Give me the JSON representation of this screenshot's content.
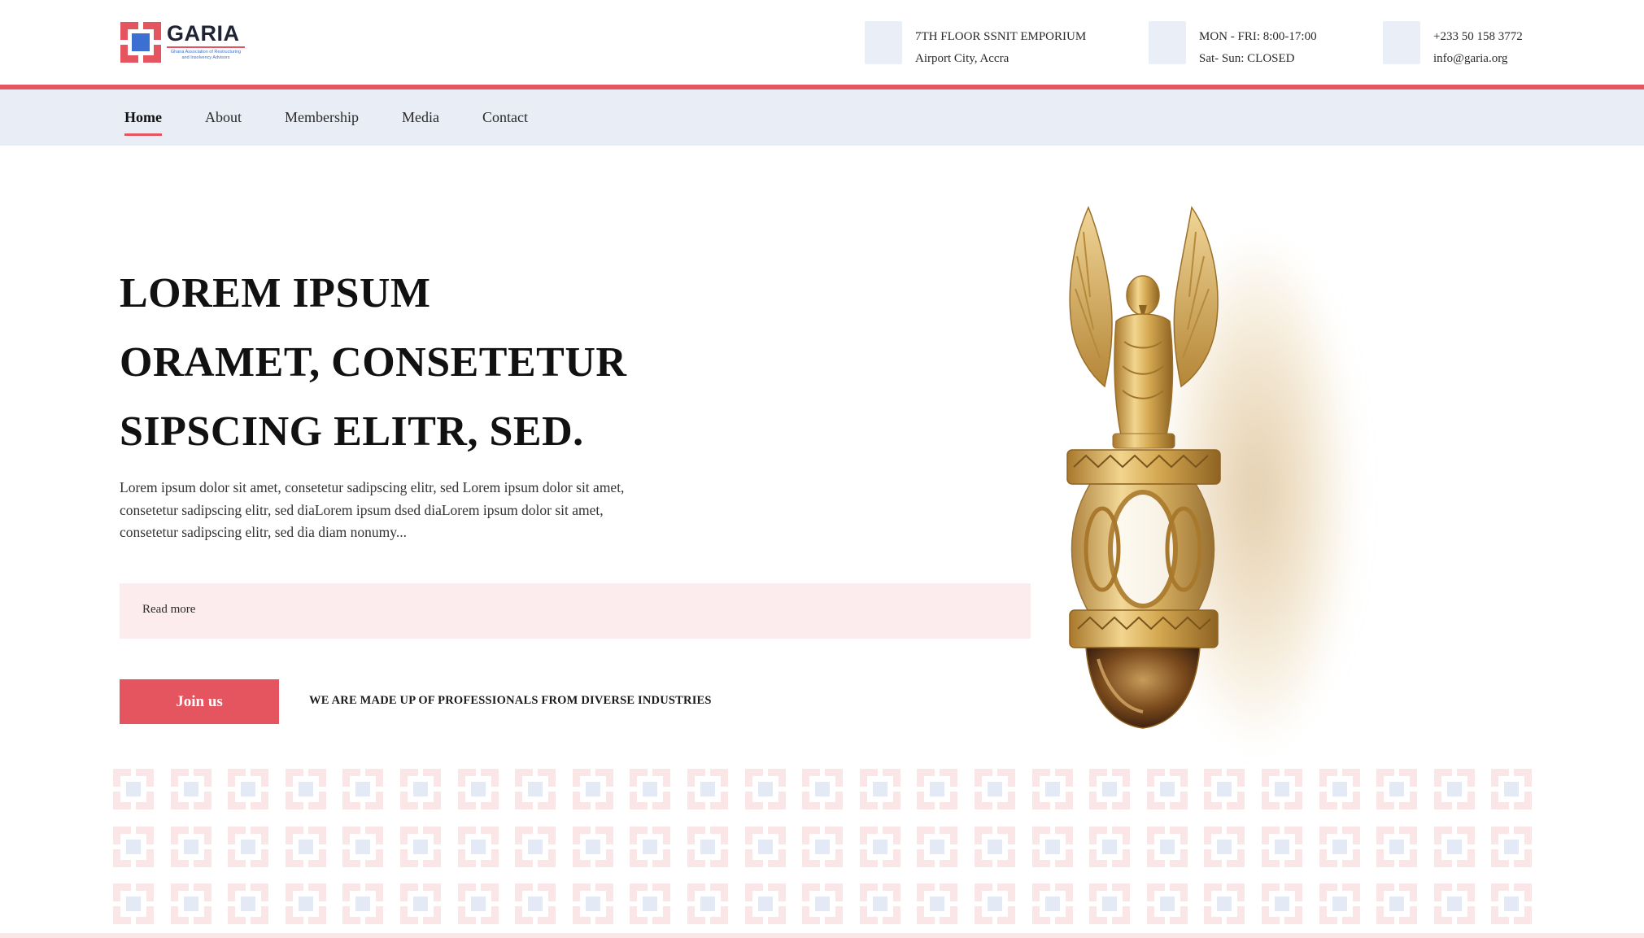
{
  "brand": {
    "name": "GARIA",
    "subtitle_line1": "Ghana Association of Restructuring",
    "subtitle_line2": "and Insolvency Advisors"
  },
  "contact_info": [
    {
      "icon": "location-icon",
      "line1": "7TH FLOOR SSNIT EMPORIUM",
      "line2": "Airport City, Accra"
    },
    {
      "icon": "clock-icon",
      "line1": "MON - FRI: 8:00-17:00",
      "line2": "Sat- Sun: CLOSED"
    },
    {
      "icon": "phone-icon",
      "line1": "+233 50 158 3772",
      "line2": "info@garia.org"
    }
  ],
  "nav": {
    "items": [
      {
        "label": "Home",
        "active": true
      },
      {
        "label": "About",
        "active": false
      },
      {
        "label": "Membership",
        "active": false
      },
      {
        "label": "Media",
        "active": false
      },
      {
        "label": "Contact",
        "active": false
      }
    ]
  },
  "hero": {
    "title_lines": [
      "LOREM IPSUM",
      "ORAMET, CONSETETUR",
      "SIPSCING ELITR, SED."
    ],
    "body": "Lorem ipsum dolor sit amet, consetetur sadipscing elitr, sed Lorem ipsum dolor sit amet, consetetur sadipscing elitr, sed diaLorem ipsum dsed diaLorem ipsum dolor sit amet, consetetur sadipscing elitr, sed dia diam nonumy...",
    "read_more": "Read more",
    "join_label": "Join us",
    "tagline": "WE ARE MADE UP OF PROFESSIONALS FROM DIVERSE INDUSTRIES"
  },
  "colors": {
    "accent": "#e5555f",
    "nav_bg": "#e8edf6",
    "logo_blue": "#3b6fd1",
    "gold": "#c9a14a",
    "pattern_pink": "#fbe6e7"
  }
}
